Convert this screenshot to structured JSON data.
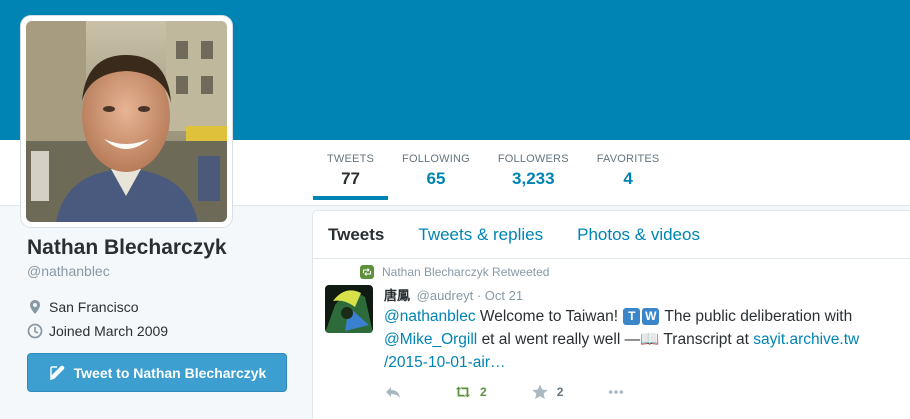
{
  "profile": {
    "name": "Nathan Blecharczyk",
    "screen_name": "@nathanblec",
    "location": "San Francisco",
    "joined": "Joined March 2009",
    "tweet_to_label": "Tweet to Nathan Blecharczyk"
  },
  "nav": [
    {
      "label": "TWEETS",
      "count": "77"
    },
    {
      "label": "FOLLOWING",
      "count": "65"
    },
    {
      "label": "FOLLOWERS",
      "count": "3,233"
    },
    {
      "label": "FAVORITES",
      "count": "4"
    }
  ],
  "tabs": [
    "Tweets",
    "Tweets & replies",
    "Photos & videos"
  ],
  "tweet": {
    "retweet_context": "Nathan Blecharczyk Retweeted",
    "author_name": "唐鳳",
    "author_handle": "@audreyt",
    "separator": "·",
    "time": "Oct 21",
    "mention1": "@nathanblec",
    "text1": "Welcome to Taiwan!",
    "badge1": "T",
    "badge2": "W",
    "text2": "The public deliberation with",
    "mention2": "@Mike_Orgill",
    "text3": "et al went really well —📖 Transcript at",
    "link1": "sayit.archive.tw",
    "link2": "/2015-10-01-air…",
    "retweets": "2",
    "favorites": "2"
  },
  "colors": {
    "banner": "#0084b4",
    "link": "#0084b4",
    "button": "#3d9fd0",
    "retweet_green": "#5c913b"
  }
}
